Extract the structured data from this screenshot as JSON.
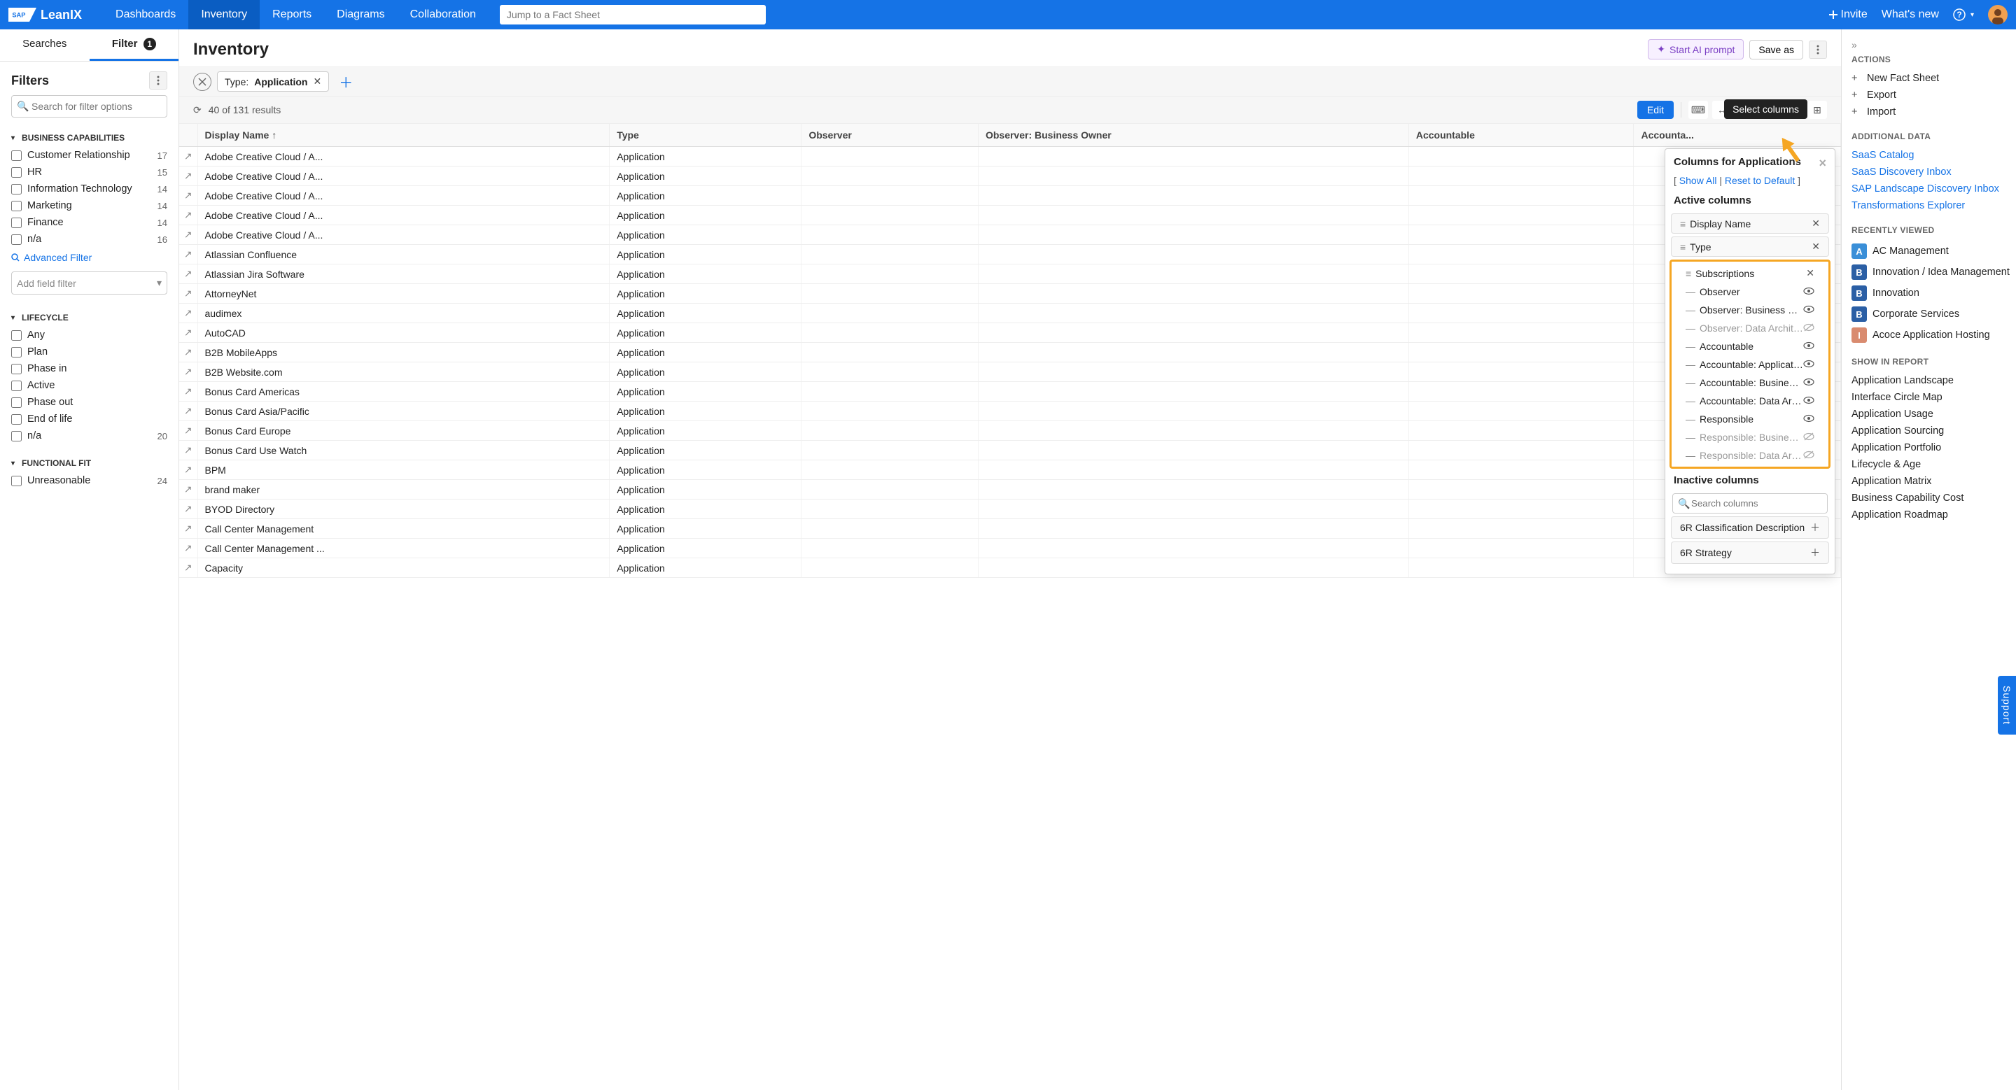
{
  "brand": "LeanIX",
  "nav": [
    "Dashboards",
    "Inventory",
    "Reports",
    "Diagrams",
    "Collaboration"
  ],
  "nav_active": 1,
  "search_placeholder": "Jump to a Fact Sheet",
  "top_right": {
    "invite": "Invite",
    "whatsnew": "What's new"
  },
  "left_tabs": {
    "searches": "Searches",
    "filter": "Filter",
    "filter_count": "1"
  },
  "filters_title": "Filters",
  "filter_search_placeholder": "Search for filter options",
  "f_business_capabilities": {
    "title": "Business Capabilities",
    "items": [
      {
        "label": "Customer Relationship",
        "count": "17"
      },
      {
        "label": "HR",
        "count": "15"
      },
      {
        "label": "Information Technology",
        "count": "14"
      },
      {
        "label": "Marketing",
        "count": "14"
      },
      {
        "label": "Finance",
        "count": "14"
      },
      {
        "label": "n/a",
        "count": "16"
      }
    ],
    "advanced": "Advanced Filter",
    "add_field": "Add field filter"
  },
  "f_lifecycle": {
    "title": "Lifecycle",
    "items": [
      {
        "label": "Any",
        "count": ""
      },
      {
        "label": "Plan",
        "count": ""
      },
      {
        "label": "Phase in",
        "count": ""
      },
      {
        "label": "Active",
        "count": ""
      },
      {
        "label": "Phase out",
        "count": ""
      },
      {
        "label": "End of life",
        "count": ""
      },
      {
        "label": "n/a",
        "count": "20"
      }
    ]
  },
  "f_functional": {
    "title": "Functional Fit",
    "items": [
      {
        "label": "Unreasonable",
        "count": "24"
      }
    ]
  },
  "page_title": "Inventory",
  "ai_prompt": "Start AI prompt",
  "save_as": "Save as",
  "pill": {
    "prefix": "Type: ",
    "value": "Application"
  },
  "results": "40 of 131 results",
  "edit": "Edit",
  "tooltip": "Select columns",
  "table_headers": [
    "Display Name ↑",
    "Type",
    "Observer",
    "Observer: Business Owner",
    "Accountable",
    "Accounta..."
  ],
  "rows": [
    {
      "name": "Adobe Creative Cloud / A...",
      "type": "Application"
    },
    {
      "name": "Adobe Creative Cloud / A...",
      "type": "Application"
    },
    {
      "name": "Adobe Creative Cloud / A...",
      "type": "Application"
    },
    {
      "name": "Adobe Creative Cloud / A...",
      "type": "Application"
    },
    {
      "name": "Adobe Creative Cloud / A...",
      "type": "Application"
    },
    {
      "name": "Atlassian Confluence",
      "type": "Application"
    },
    {
      "name": "Atlassian Jira Software",
      "type": "Application"
    },
    {
      "name": "AttorneyNet",
      "type": "Application"
    },
    {
      "name": "audimex",
      "type": "Application"
    },
    {
      "name": "AutoCAD",
      "type": "Application"
    },
    {
      "name": "B2B MobileApps",
      "type": "Application"
    },
    {
      "name": "B2B Website.com",
      "type": "Application"
    },
    {
      "name": "Bonus Card Americas",
      "type": "Application"
    },
    {
      "name": "Bonus Card Asia/Pacific",
      "type": "Application"
    },
    {
      "name": "Bonus Card Europe",
      "type": "Application"
    },
    {
      "name": "Bonus Card Use Watch",
      "type": "Application"
    },
    {
      "name": "BPM",
      "type": "Application"
    },
    {
      "name": "brand maker",
      "type": "Application"
    },
    {
      "name": "BYOD Directory",
      "type": "Application"
    },
    {
      "name": "Call Center Management",
      "type": "Application"
    },
    {
      "name": "Call Center Management ...",
      "type": "Application"
    },
    {
      "name": "Capacity",
      "type": "Application"
    }
  ],
  "col_popup": {
    "title": "Columns for Applications",
    "show_all": "Show All",
    "reset": "Reset to Default",
    "active_title": "Active columns",
    "active": [
      {
        "label": "Display Name",
        "removable": true
      },
      {
        "label": "Type",
        "removable": true
      }
    ],
    "highlighted": [
      {
        "label": "Subscriptions",
        "action": "x",
        "dim": false
      },
      {
        "label": "Observer",
        "action": "eye",
        "dim": false
      },
      {
        "label": "Observer: Business Owner",
        "action": "eye",
        "dim": false
      },
      {
        "label": "Observer: Data Architect",
        "action": "eyeoff",
        "dim": true
      },
      {
        "label": "Accountable",
        "action": "eye",
        "dim": false
      },
      {
        "label": "Accountable: Application ...",
        "action": "eye",
        "dim": false
      },
      {
        "label": "Accountable: Business O...",
        "action": "eye",
        "dim": false
      },
      {
        "label": "Accountable: Data Architect",
        "action": "eye",
        "dim": false
      },
      {
        "label": "Responsible",
        "action": "eye",
        "dim": false
      },
      {
        "label": "Responsible: Business O...",
        "action": "eyeoff",
        "dim": true
      },
      {
        "label": "Responsible: Data Architect",
        "action": "eyeoff",
        "dim": true
      }
    ],
    "inactive_title": "Inactive columns",
    "search_placeholder": "Search columns",
    "inactive": [
      {
        "label": "6R Classification Description"
      },
      {
        "label": "6R Strategy"
      }
    ]
  },
  "right_panel": {
    "actions": {
      "title": "ACTIONS",
      "items": [
        "New Fact Sheet",
        "Export",
        "Import"
      ]
    },
    "additional": {
      "title": "ADDITIONAL DATA",
      "items": [
        "SaaS Catalog",
        "SaaS Discovery Inbox",
        "SAP Landscape Discovery Inbox",
        "Transformations Explorer"
      ]
    },
    "recent": {
      "title": "RECENTLY VIEWED",
      "items": [
        {
          "badge": "A",
          "cls": "a",
          "label": "AC Management"
        },
        {
          "badge": "B",
          "cls": "b",
          "label": "Innovation / Idea Management"
        },
        {
          "badge": "B",
          "cls": "b",
          "label": "Innovation"
        },
        {
          "badge": "B",
          "cls": "b",
          "label": "Corporate Services"
        },
        {
          "badge": "I",
          "cls": "i",
          "label": "Acoce Application Hosting"
        }
      ]
    },
    "show_report": {
      "title": "SHOW IN REPORT",
      "items": [
        "Application Landscape",
        "Interface Circle Map",
        "Application Usage",
        "Application Sourcing",
        "Application Portfolio",
        "Lifecycle & Age",
        "Application Matrix",
        "Business Capability Cost",
        "Application Roadmap"
      ]
    }
  },
  "support": "Support"
}
